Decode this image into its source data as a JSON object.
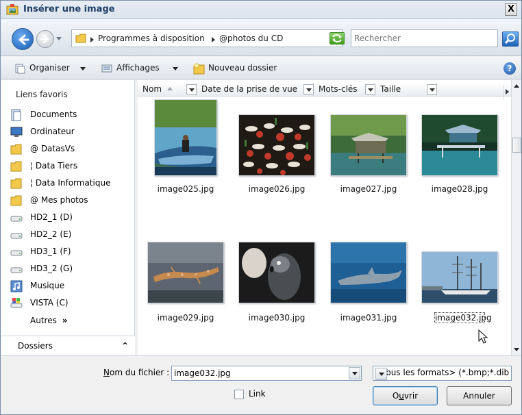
{
  "window": {
    "title": "Insérer une image",
    "close_label": "X"
  },
  "address": {
    "crumbs": [
      "Programmes à disposition",
      "@photos du CD"
    ],
    "search_placeholder": "Rechercher"
  },
  "toolbar": {
    "organize": "Organiser",
    "views": "Affichages",
    "new_folder": "Nouveau dossier",
    "help": "?"
  },
  "nav": {
    "title": "Liens favoris",
    "items": [
      {
        "label": "Documents",
        "icon": "documents-icon"
      },
      {
        "label": "Ordinateur",
        "icon": "computer-icon"
      },
      {
        "label": "@ DatasVs",
        "icon": "folder-icon"
      },
      {
        "label": "¦ Data Tiers",
        "icon": "folder-icon"
      },
      {
        "label": "¦ Data Informatique",
        "icon": "folder-icon"
      },
      {
        "label": "@ Mes photos",
        "icon": "folder-icon"
      },
      {
        "label": "HD2_1 (D)",
        "icon": "drive-icon"
      },
      {
        "label": "HD2_2 (E)",
        "icon": "drive-icon"
      },
      {
        "label": "HD3_1 (F)",
        "icon": "drive-icon"
      },
      {
        "label": "HD3_2 (G)",
        "icon": "drive-icon"
      },
      {
        "label": "Musique",
        "icon": "music-icon"
      },
      {
        "label": "VISTA (C)",
        "icon": "system-drive-icon"
      }
    ],
    "more_label": "Autres",
    "more_chevron": "»",
    "folders_label": "Dossiers",
    "folders_chevron": "^"
  },
  "columns": [
    "Nom",
    "Date de la prise de vue",
    "Mots-clés",
    "Taille"
  ],
  "files": [
    {
      "name": "image025.jpg",
      "subject": "boat-photo"
    },
    {
      "name": "image026.jpg",
      "subject": "flowers-photo"
    },
    {
      "name": "image027.jpg",
      "subject": "hut-photo"
    },
    {
      "name": "image028.jpg",
      "subject": "pier-photo"
    },
    {
      "name": "image029.jpg",
      "subject": "gecko-photo"
    },
    {
      "name": "image030.jpg",
      "subject": "parrot-photo"
    },
    {
      "name": "image031.jpg",
      "subject": "dolphin-photo"
    },
    {
      "name": "image032.jpg",
      "subject": "ship-photo",
      "selected": true
    }
  ],
  "bottom": {
    "filename_label_u": "N",
    "filename_label_rest": "om du fichier :",
    "filename_value": "image032.jpg",
    "filetype_value": "<Tous les formats> (*.bmp;*.dib",
    "link_label": "Link",
    "open_u": "u",
    "open_pre": "O",
    "open_post": "vrir",
    "cancel": "Annuler"
  },
  "colors": {
    "titlebar_text": "#1e3f66",
    "selection_dots": "#333333"
  }
}
